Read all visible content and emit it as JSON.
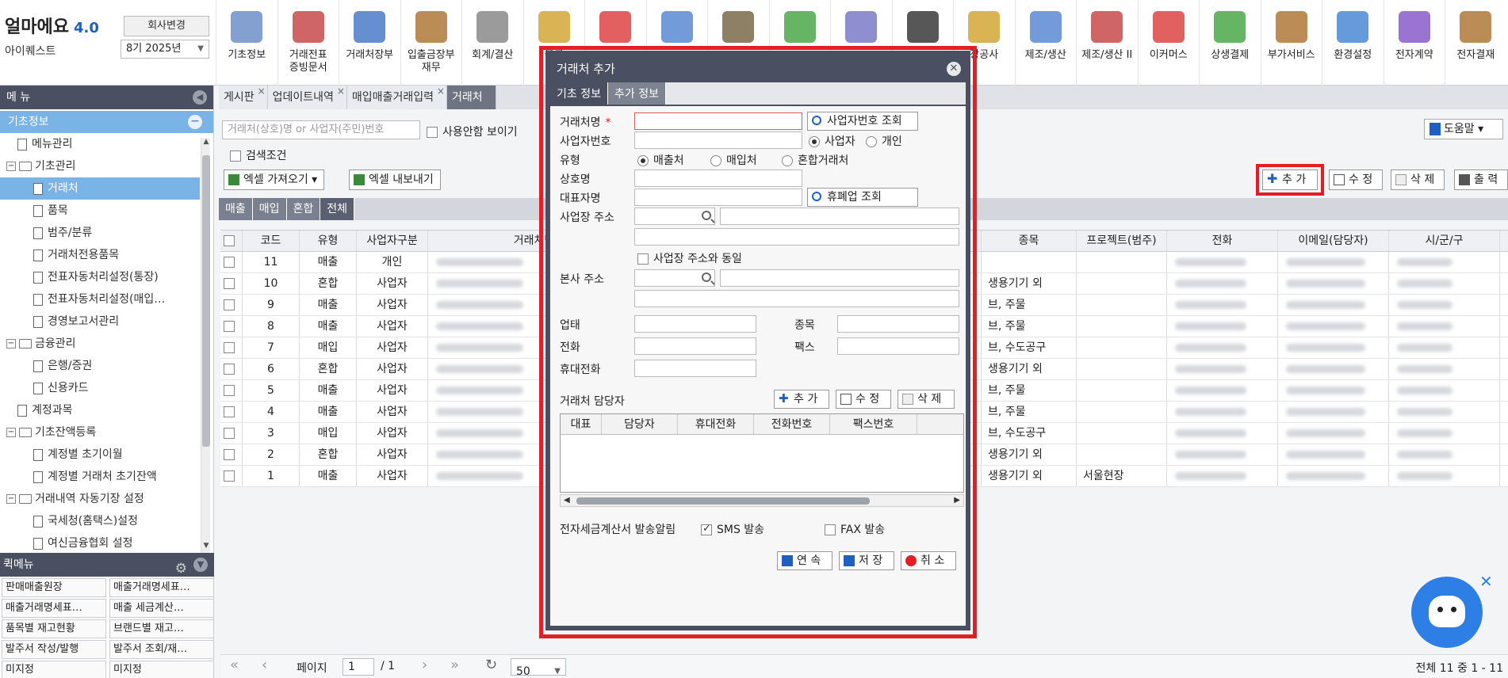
{
  "app": {
    "logo": "얼마에요",
    "version": "4.0",
    "company": "아이퀘스트",
    "change_company": "회사변경",
    "period": "8기 2025년"
  },
  "modules": [
    {
      "label": "기초정보",
      "icon": "clipboard-icon",
      "color": "#6f8fc8"
    },
    {
      "label": "거래전표\n증빙문서",
      "icon": "receipt-icon",
      "color": "#c84a4a"
    },
    {
      "label": "거래처장부",
      "icon": "ledger-icon",
      "color": "#4a7bc8"
    },
    {
      "label": "입출금장부\n재무",
      "icon": "money-bag-icon",
      "color": "#b0783a"
    },
    {
      "label": "회계/결산",
      "icon": "calculator-icon",
      "color": "#8a8a8a"
    },
    {
      "label": "물류",
      "icon": "cart-icon",
      "color": "#d4a636"
    },
    {
      "label": "",
      "icon": "invoice-icon",
      "color": "#d44"
    },
    {
      "label": "",
      "icon": "tax-doc-icon",
      "color": "#5a8ad4"
    },
    {
      "label": "",
      "icon": "person-doc-icon",
      "color": "#7a6a4a"
    },
    {
      "label": "",
      "icon": "refund-icon",
      "color": "#4aa84a"
    },
    {
      "label": "",
      "icon": "people-icon",
      "color": "#7a7ac8"
    },
    {
      "label": "",
      "icon": "ship-icon",
      "color": "#3a3a3a"
    },
    {
      "label": "장공사",
      "icon": "excavator-icon",
      "color": "#d4a636"
    },
    {
      "label": "제조/생산",
      "icon": "factory-icon",
      "color": "#5a8ad4"
    },
    {
      "label": "제조/생산 II",
      "icon": "factory-2-icon",
      "color": "#c84a4a"
    },
    {
      "label": "이커머스",
      "icon": "shop-icon",
      "color": "#d44"
    },
    {
      "label": "상생결제",
      "icon": "banknote-icon",
      "color": "#4aa84a"
    },
    {
      "label": "부가서비스",
      "icon": "bank-icon",
      "color": "#b0783a"
    },
    {
      "label": "환경설정",
      "icon": "gear-icon",
      "color": "#4a8ad4"
    },
    {
      "label": "전자계약",
      "icon": "pen-icon",
      "color": "#8a5ac8"
    },
    {
      "label": "전자결재",
      "icon": "approval-icon",
      "color": "#b0783a"
    }
  ],
  "sidebar": {
    "title": "메 뉴",
    "root": "기초정보",
    "items": [
      {
        "label": "메뉴관리",
        "level": 1,
        "type": "doc"
      },
      {
        "label": "기초관리",
        "level": 0,
        "type": "folder"
      },
      {
        "label": "거래처",
        "level": 2,
        "type": "doc",
        "selected": true
      },
      {
        "label": "품목",
        "level": 2,
        "type": "doc"
      },
      {
        "label": "범주/분류",
        "level": 2,
        "type": "doc"
      },
      {
        "label": "거래처전용품목",
        "level": 2,
        "type": "doc"
      },
      {
        "label": "전표자동처리설정(통장)",
        "level": 2,
        "type": "doc"
      },
      {
        "label": "전표자동처리설정(매입…",
        "level": 2,
        "type": "doc"
      },
      {
        "label": "경영보고서관리",
        "level": 2,
        "type": "doc"
      },
      {
        "label": "금융관리",
        "level": 0,
        "type": "folder"
      },
      {
        "label": "은행/증권",
        "level": 2,
        "type": "doc"
      },
      {
        "label": "신용카드",
        "level": 2,
        "type": "doc"
      },
      {
        "label": "계정과목",
        "level": 1,
        "type": "doc"
      },
      {
        "label": "기초잔액등록",
        "level": 0,
        "type": "folder"
      },
      {
        "label": "계정별 초기이월",
        "level": 2,
        "type": "doc"
      },
      {
        "label": "계정별 거래처 초기잔액",
        "level": 2,
        "type": "doc"
      },
      {
        "label": "거래내역 자동기장 설정",
        "level": 0,
        "type": "folder"
      },
      {
        "label": "국세청(홈택스)설정",
        "level": 2,
        "type": "doc"
      },
      {
        "label": "여신금융협회 설정",
        "level": 2,
        "type": "doc"
      }
    ],
    "quick_title": "퀵메뉴",
    "quick": [
      "판매매출원장",
      "매출거래명세표…",
      "매출거래명세표…",
      "매출 세금계산…",
      "품목별 재고현황",
      "브랜드별 재고…",
      "발주서 작성/발행",
      "발주서 조회/재…",
      "미지정",
      "미지정"
    ]
  },
  "tabs": [
    {
      "label": "게시판",
      "active": false
    },
    {
      "label": "업데이트내역",
      "active": false
    },
    {
      "label": "매입매출거래입력",
      "active": false
    },
    {
      "label": "거래처",
      "active": true
    }
  ],
  "toolbar": {
    "search_placeholder": "거래처(상호)명 or 사업자(주민)번호",
    "show_unused": "사용안함 보이기",
    "help": "도움말",
    "search_condition": "검색조건",
    "excel_import": "엑셀 가져오기",
    "excel_export": "엑셀 내보내기",
    "add": "추 가",
    "edit": "수 정",
    "delete": "삭 제",
    "print": "출 력"
  },
  "sub_tabs": [
    {
      "label": "매출",
      "active": false
    },
    {
      "label": "매입",
      "active": false
    },
    {
      "label": "혼합",
      "active": false
    },
    {
      "label": "전체",
      "active": true
    }
  ],
  "grid": {
    "columns": [
      "",
      "코드",
      "유형",
      "사업자구분",
      "거래처명",
      "",
      "",
      "",
      "",
      "",
      "종목",
      "프로젝트(범주)",
      "전화",
      "이메일(담당자)",
      "시/군/구"
    ],
    "rows": [
      {
        "code": "11",
        "type": "매출",
        "biz": "개인",
        "item": "",
        "project": ""
      },
      {
        "code": "10",
        "type": "혼합",
        "biz": "사업자",
        "item": "생용기기 외",
        "project": ""
      },
      {
        "code": "9",
        "type": "매출",
        "biz": "사업자",
        "item": "브, 주물",
        "project": ""
      },
      {
        "code": "8",
        "type": "매출",
        "biz": "사업자",
        "item": "브, 주물",
        "project": ""
      },
      {
        "code": "7",
        "type": "매입",
        "biz": "사업자",
        "item": "브, 수도공구",
        "project": ""
      },
      {
        "code": "6",
        "type": "혼합",
        "biz": "사업자",
        "item": "생용기기 외",
        "project": ""
      },
      {
        "code": "5",
        "type": "매출",
        "biz": "사업자",
        "item": "브, 주물",
        "project": ""
      },
      {
        "code": "4",
        "type": "매출",
        "biz": "사업자",
        "item": "브, 주물",
        "project": ""
      },
      {
        "code": "3",
        "type": "매입",
        "biz": "사업자",
        "item": "브, 수도공구",
        "project": ""
      },
      {
        "code": "2",
        "type": "혼합",
        "biz": "사업자",
        "item": "생용기기 외",
        "project": ""
      },
      {
        "code": "1",
        "type": "매출",
        "biz": "사업자",
        "item": "생용기기 외",
        "project": "서울현장"
      }
    ]
  },
  "modal": {
    "title": "거래처 추가",
    "tabs": [
      {
        "label": "기초 정보",
        "active": true
      },
      {
        "label": "추가 정보",
        "active": false
      }
    ],
    "name_label": "거래처명",
    "required_mark": "*",
    "biz_lookup": "사업자번호 조회",
    "biz_no_label": "사업자번호",
    "radio_business": "사업자",
    "radio_individual": "개인",
    "type_label": "유형",
    "type_sales": "매출처",
    "type_purchase": "매입처",
    "type_mixed": "혼합거래처",
    "trade_name_label": "상호명",
    "ceo_label": "대표자명",
    "closure_lookup": "휴폐업 조회",
    "biz_addr_label": "사업장 주소",
    "same_as_biz": "사업장 주소와 동일",
    "hq_addr_label": "본사 주소",
    "biz_type_label": "업태",
    "biz_item_label": "종목",
    "phone_label": "전화",
    "fax_label": "팩스",
    "mobile_label": "휴대전화",
    "contact_label": "거래처 담당자",
    "contact_add": "추 가",
    "contact_edit": "수 정",
    "contact_delete": "삭 제",
    "contact_columns": [
      "대표",
      "담당자",
      "휴대전화",
      "전화번호",
      "팩스번호"
    ],
    "notify_label": "전자세금계산서 발송알림",
    "sms": "SMS 발송",
    "fax_send": "FAX 발송",
    "continue": "연 속",
    "save": "저 장",
    "cancel": "취 소"
  },
  "pager": {
    "page_label": "페이지",
    "page": "1",
    "total_pages": "/ 1",
    "page_size": "50",
    "summary": "전체 11 중 1 - 11"
  }
}
